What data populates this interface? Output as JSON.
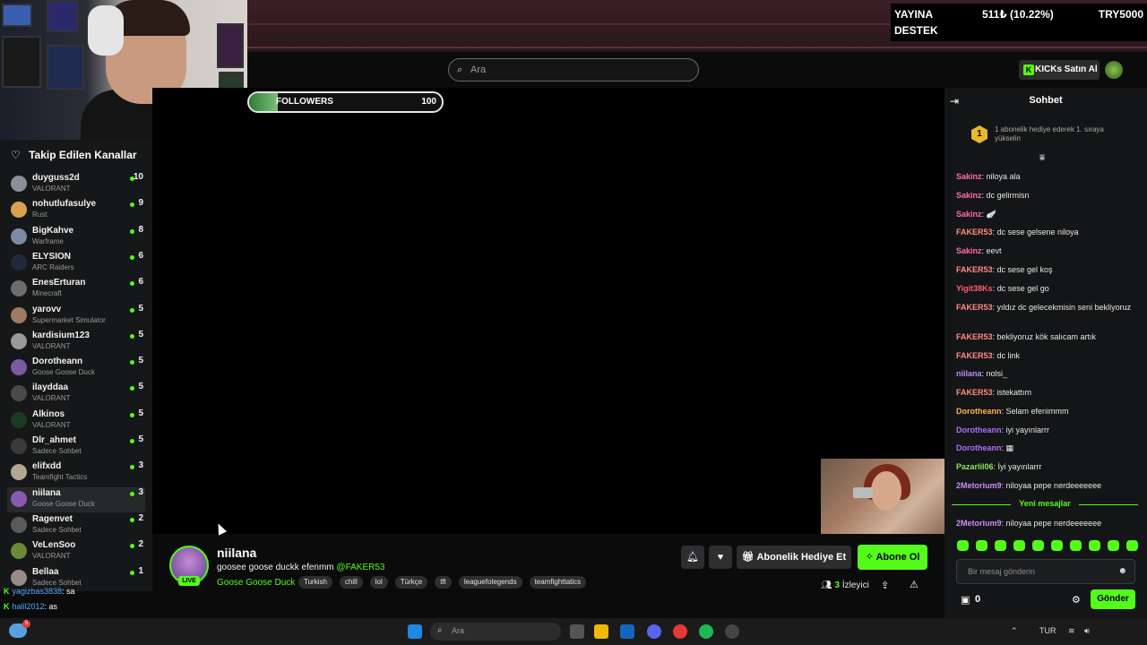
{
  "overlay": {
    "donation_line1": "YAYINA",
    "donation_line2": "DESTEK",
    "donation_amount": "511₺ (10.22%)",
    "donation_goal": "TRY5000",
    "followers_label": "FOLLOWERS",
    "followers_value": "100",
    "followers_progress": 0.15
  },
  "header": {
    "search_placeholder": "Ara",
    "kicks_button": "KICKs Satın Al",
    "kicks_icon": "K"
  },
  "sidebar": {
    "title": "Takip Edilen Kanallar",
    "channels": [
      {
        "name": "duyguss2d",
        "game": "VALORANT",
        "viewers": "10",
        "color": "#8a8f99"
      },
      {
        "name": "nohutlufasulye",
        "game": "Rust",
        "viewers": "9",
        "color": "#d6a24c"
      },
      {
        "name": "BigKahve",
        "game": "Warframe",
        "viewers": "8",
        "color": "#7b8ba0"
      },
      {
        "name": "ELYSION",
        "game": "ARC Raiders",
        "viewers": "6",
        "color": "#1f2a3a"
      },
      {
        "name": "EnesErturan",
        "game": "Minecraft",
        "viewers": "6",
        "color": "#6d6d6d"
      },
      {
        "name": "yarovv",
        "game": "Supermarket Simulator",
        "viewers": "5",
        "color": "#a07a62"
      },
      {
        "name": "kardisium123",
        "game": "VALORANT",
        "viewers": "5",
        "color": "#9a9a9a"
      },
      {
        "name": "Dorotheann",
        "game": "Goose Goose Duck",
        "viewers": "5",
        "color": "#7a5aa0"
      },
      {
        "name": "ilayddaa",
        "game": "VALORANT",
        "viewers": "5",
        "color": "#4a4a4a"
      },
      {
        "name": "Alkinos",
        "game": "VALORANT",
        "viewers": "5",
        "color": "#1d3b22"
      },
      {
        "name": "Dlr_ahmet",
        "game": "Sadece Sohbet",
        "viewers": "5",
        "color": "#3a3a3a"
      },
      {
        "name": "elifxdd",
        "game": "Teamfight Tactics",
        "viewers": "3",
        "color": "#b0a890"
      },
      {
        "name": "niilana",
        "game": "Goose Goose Duck",
        "viewers": "3",
        "color": "#8a5ab0"
      },
      {
        "name": "Ragenvet",
        "game": "Sadece Sohbet",
        "viewers": "2",
        "color": "#5a5a5a"
      },
      {
        "name": "VeLenSoo",
        "game": "VALORANT",
        "viewers": "2",
        "color": "#6a8a3a"
      },
      {
        "name": "Bellaa",
        "game": "Sadece Sohbet",
        "viewers": "1",
        "color": "#9a8a8a"
      }
    ]
  },
  "overlay_chat": [
    {
      "user": "yagizbas3838",
      "text": ": sa"
    },
    {
      "user": "halil2012",
      "text": ": as"
    }
  ],
  "stream": {
    "name": "niilana",
    "live": "LIVE",
    "title": "goosee goose duckk efenmm",
    "mention": "@FAKER53",
    "category": "Goose Goose Duck",
    "tags": [
      "Turkish",
      "chill",
      "lol",
      "Türkçe",
      "tft",
      "leaguefolegends",
      "teamfighttatics"
    ],
    "gift_button": "Abonelik Hediye Et",
    "subscribe_button": "Abone Ol",
    "viewer_count": "3",
    "viewer_label": "İzleyici"
  },
  "chat": {
    "title": "Sohbet",
    "rank": "1",
    "gift_note": "1 abonelik hediye ederek 1. sıraya yükselin",
    "new_messages": "Yeni mesajlar",
    "input_placeholder": "Bir mesaj gönderin",
    "send_button": "Gönder",
    "kicks_count": "0",
    "messages": [
      {
        "user": "Sakinz",
        "text": ": niloya ala",
        "color": "#ff6fa4"
      },
      {
        "user": "Sakinz",
        "text": ": dc gelirmisn",
        "color": "#ff6fa4"
      },
      {
        "user": "Sakinz",
        "text": ": 🪽",
        "color": "#ff6fa4"
      },
      {
        "user": "FAKER53",
        "text": ": dc sese gelsene niloya",
        "color": "#ff8a8a"
      },
      {
        "user": "Sakinz",
        "text": ": eevt",
        "color": "#ff6fa4"
      },
      {
        "user": "FAKER53",
        "text": ": dc sese gel koş",
        "color": "#ff8a8a"
      },
      {
        "user": "Yigit38Ks",
        "text": ": dc sese gel go",
        "color": "#ff5a7a"
      },
      {
        "user": "FAKER53",
        "text": ": yıldız dc gelecekmisin seni bekliyoruz",
        "color": "#ff8a8a"
      },
      {
        "user": "FAKER53",
        "text": ": bekliyoruz kök salıcam artık",
        "color": "#ff8a8a"
      },
      {
        "user": "FAKER53",
        "text": ": dc link",
        "color": "#ff8a8a"
      },
      {
        "user": "niilana",
        "text": ": nolsi_",
        "color": "#b58cff"
      },
      {
        "user": "FAKER53",
        "text": ": istekattım",
        "color": "#ff8a8a"
      },
      {
        "user": "Dorotheann",
        "text": ": Selam efenimmm",
        "color": "#ffb05a"
      },
      {
        "user": "Dorotheann",
        "text": ": iyi yayınlarrr",
        "color": "#b06bff"
      },
      {
        "user": "Dorotheann",
        "text": ": ▦",
        "color": "#b06bff"
      },
      {
        "user": "Pazarlil06",
        "text": ": İyi yayınlarrr",
        "color": "#8ae65a"
      },
      {
        "user": "2Metorium9",
        "text": ": niloyaa pepe nerdeeeeeee",
        "color": "#c88cff"
      },
      {
        "user": "2Metorium9",
        "text": ": niloyaa pepe nerdeeeeeee",
        "color": "#c88cff"
      }
    ]
  },
  "taskbar": {
    "search_placeholder": "Ara",
    "weather_badge": "5",
    "tray_lang": "TUR"
  }
}
